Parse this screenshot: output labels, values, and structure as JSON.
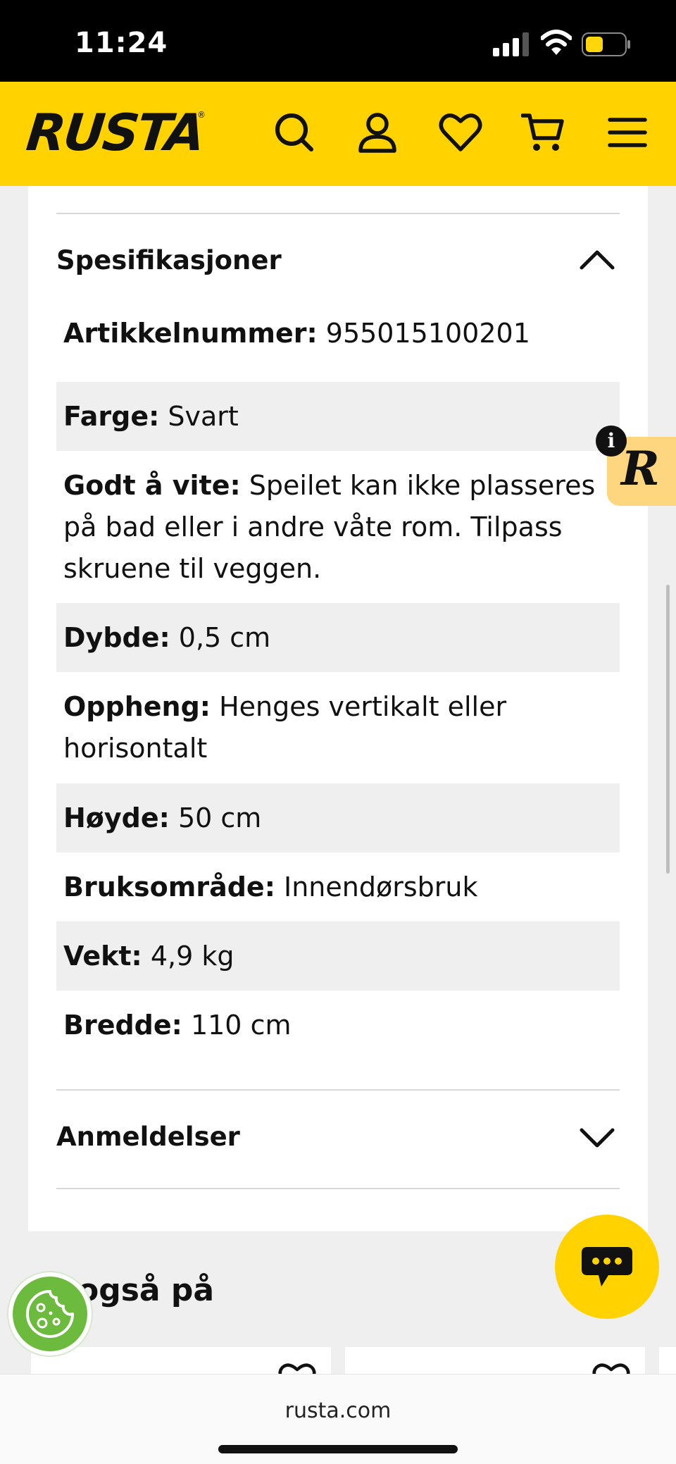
{
  "status_bar": {
    "time": "11:24"
  },
  "header": {
    "logo": "RUSTA",
    "logo_mark": "®"
  },
  "specs": {
    "title": "Spesifikasjoner",
    "rows": [
      {
        "key": "Artikkelnummer:",
        "value": "955015100201"
      },
      {
        "key": "Farge:",
        "value": "Svart"
      },
      {
        "key": "Godt å vite:",
        "value": "Speilet kan ikke plasseres",
        "value2": "på bad eller i andre våte rom. Tilpass",
        "value3": "skruene til veggen."
      },
      {
        "key": "Dybde:",
        "value": "0,5 cm"
      },
      {
        "key": "Oppheng:",
        "value": "Henges vertikalt eller",
        "value2": "horisontalt"
      },
      {
        "key": "Høyde:",
        "value": "50 cm"
      },
      {
        "key": "Bruksområde:",
        "value": "Innendørsbruk"
      },
      {
        "key": "Vekt:",
        "value": "4,9 kg"
      },
      {
        "key": "Bredde:",
        "value": "110 cm"
      }
    ]
  },
  "reviews": {
    "title": "Anmeldelser"
  },
  "also": {
    "title": "også på"
  },
  "badge": {
    "letter": "R",
    "info": "i"
  },
  "browser": {
    "url": "rusta.com"
  },
  "colors": {
    "brand_yellow": "#ffd200",
    "cookie_green": "#6dbb3e",
    "shade": "#efefef"
  }
}
